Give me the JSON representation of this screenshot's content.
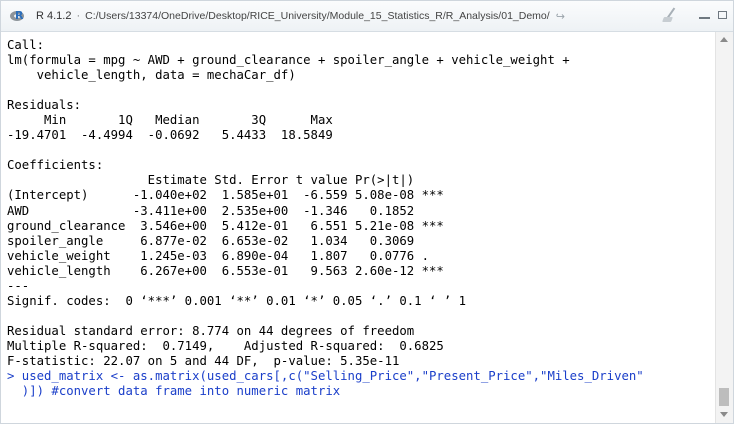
{
  "titlebar": {
    "version": "R 4.1.2",
    "separator": "·",
    "path": "C:/Users/13374/OneDrive/Desktop/RICE_University/Module_15_Statistics_R/R_Analysis/01_Demo/",
    "icons": [
      "r-logo-icon",
      "goto-directory-icon",
      "broom-icon",
      "minimize-icon",
      "maximize-icon"
    ]
  },
  "console": {
    "output_lines": [
      "Call:",
      "lm(formula = mpg ~ AWD + ground_clearance + spoiler_angle + vehicle_weight +",
      "    vehicle_length, data = mechaCar_df)",
      "",
      "Residuals:",
      "     Min       1Q   Median       3Q      Max ",
      "-19.4701  -4.4994  -0.0692   5.4433  18.5849 ",
      "",
      "Coefficients:",
      "                   Estimate Std. Error t value Pr(>|t|)    ",
      "(Intercept)      -1.040e+02  1.585e+01  -6.559 5.08e-08 ***",
      "AWD              -3.411e+00  2.535e+00  -1.346   0.1852    ",
      "ground_clearance  3.546e+00  5.412e-01   6.551 5.21e-08 ***",
      "spoiler_angle     6.877e-02  6.653e-02   1.034   0.3069    ",
      "vehicle_weight    1.245e-03  6.890e-04   1.807   0.0776 .  ",
      "vehicle_length    6.267e+00  6.553e-01   9.563 2.60e-12 ***",
      "---",
      "Signif. codes:  0 ‘***’ 0.001 ‘**’ 0.01 ‘*’ 0.05 ‘.’ 0.1 ‘ ’ 1",
      "",
      "Residual standard error: 8.774 on 44 degrees of freedom",
      "Multiple R-squared:  0.7149,\tAdjusted R-squared:  0.6825 ",
      "F-statistic: 22.07 on 5 and 44 DF,  p-value: 5.35e-11",
      ""
    ],
    "input_lines": [
      "> used_matrix <- as.matrix(used_cars[,c(\"Selling_Price\",\"Present_Price\",\"Miles_Driven\"",
      "  )]) #convert data frame into numeric matrix"
    ]
  }
}
